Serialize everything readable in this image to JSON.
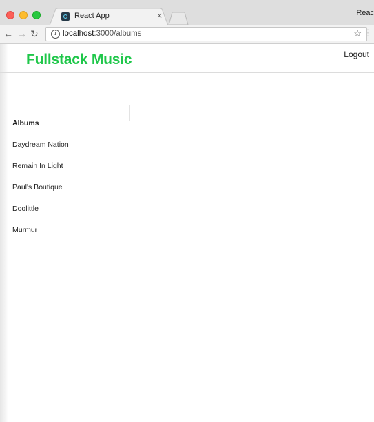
{
  "browser": {
    "tab_title": "React App",
    "tab_close": "×",
    "profile_label": "Reac",
    "url_host": "localhost",
    "url_rest": ":3000/albums",
    "icons": {
      "back": "arrow-left-icon",
      "forward": "arrow-right-icon",
      "reload": "reload-icon",
      "info": "info-icon",
      "bookmark": "star-icon",
      "menu": "vertical-dots-icon"
    }
  },
  "header": {
    "brand": "Fullstack Music",
    "brand_color": "#1fc74a",
    "logout_label": "Logout"
  },
  "sidebar": {
    "title": "Albums",
    "albums": [
      "Daydream Nation",
      "Remain In Light",
      "Paul's Boutique",
      "Doolittle",
      "Murmur"
    ]
  }
}
